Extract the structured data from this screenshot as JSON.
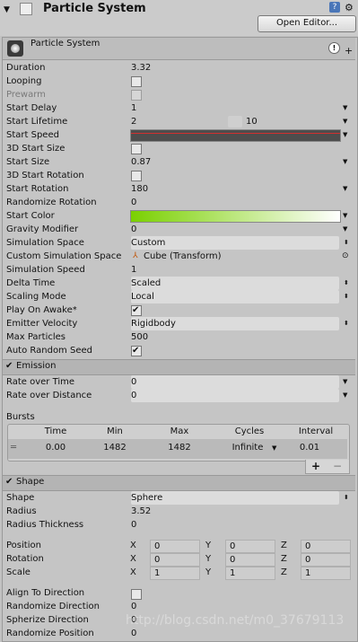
{
  "header": {
    "title": "Particle System",
    "open_editor_label": "Open Editor..."
  },
  "module": {
    "title": "Particle System",
    "help_icon_glyph": "?",
    "bubble_glyph": "!",
    "plus_glyph": "+"
  },
  "main_props": [
    {
      "label": "Duration",
      "value": "3.32",
      "type": "text"
    },
    {
      "label": "Looping",
      "type": "checkbox",
      "checked": false
    },
    {
      "label": "Prewarm",
      "type": "checkbox",
      "checked": false,
      "disabled": true
    },
    {
      "label": "Start Delay",
      "value": "1",
      "type": "text",
      "arrow": true
    },
    {
      "label": "Start Lifetime",
      "value": "2",
      "value2": "10",
      "type": "range",
      "arrow": true
    },
    {
      "label": "Start Speed",
      "type": "curve",
      "arrow": true
    },
    {
      "label": "3D Start Size",
      "type": "checkbox",
      "checked": false
    },
    {
      "label": "Start Size",
      "value": "0.87",
      "type": "text",
      "arrow": true
    },
    {
      "label": "3D Start Rotation",
      "type": "checkbox",
      "checked": false
    },
    {
      "label": "Start Rotation",
      "value": "180",
      "type": "text",
      "arrow": true
    },
    {
      "label": "Randomize Rotation",
      "value": "0",
      "type": "text"
    },
    {
      "label": "Start Color",
      "type": "gradient",
      "arrow": true
    },
    {
      "label": "Gravity Modifier",
      "value": "0",
      "type": "text",
      "arrow": true
    },
    {
      "label": "Simulation Space",
      "value": "Custom",
      "type": "select"
    },
    {
      "label": "Custom Simulation Space",
      "value": "Cube (Transform)",
      "type": "object"
    },
    {
      "label": "Simulation Speed",
      "value": "1",
      "type": "text"
    },
    {
      "label": "Delta Time",
      "value": "Scaled",
      "type": "select"
    },
    {
      "label": "Scaling Mode",
      "value": "Local",
      "type": "select"
    },
    {
      "label": "Play On Awake*",
      "type": "checkbox",
      "checked": true
    },
    {
      "label": "Emitter Velocity",
      "value": "Rigidbody",
      "type": "select"
    },
    {
      "label": "Max Particles",
      "value": "500",
      "type": "text"
    },
    {
      "label": "Auto Random Seed",
      "type": "checkbox",
      "checked": true
    }
  ],
  "emission": {
    "title": "Emission",
    "props": [
      {
        "label": "Rate over Time",
        "value": "0"
      },
      {
        "label": "Rate over Distance",
        "value": "0"
      }
    ],
    "bursts_label": "Bursts",
    "bursts_headers": [
      "Time",
      "Min",
      "Max",
      "Cycles",
      "Interval"
    ],
    "bursts_row": [
      "0.00",
      "1482",
      "1482",
      "Infinite",
      "0.01"
    ],
    "add_glyph": "+",
    "remove_glyph": "−"
  },
  "shape": {
    "title": "Shape",
    "props": [
      {
        "label": "Shape",
        "value": "Sphere",
        "type": "select"
      },
      {
        "label": "Radius",
        "value": "3.52",
        "type": "text"
      },
      {
        "label": "Radius Thickness",
        "value": "0",
        "type": "text"
      }
    ],
    "vectors": [
      {
        "label": "Position",
        "x": "0",
        "y": "0",
        "z": "0"
      },
      {
        "label": "Rotation",
        "x": "0",
        "y": "0",
        "z": "0"
      },
      {
        "label": "Scale",
        "x": "1",
        "y": "1",
        "z": "1"
      }
    ],
    "axis_labels": [
      "X",
      "Y",
      "Z"
    ],
    "bottom_props": [
      {
        "label": "Align To Direction",
        "type": "checkbox",
        "checked": false
      },
      {
        "label": "Randomize Direction",
        "value": "0",
        "type": "text"
      },
      {
        "label": "Spherize Direction",
        "value": "0",
        "type": "text"
      },
      {
        "label": "Randomize Position",
        "value": "0",
        "type": "text"
      }
    ]
  },
  "watermark": "http://blog.csdn.net/m0_37679113",
  "colors": {
    "start_color_from": "#7ad000",
    "start_color_to": "#ffffff",
    "curve_bg": "#4d4d4d",
    "curve_line": "#d03030"
  }
}
